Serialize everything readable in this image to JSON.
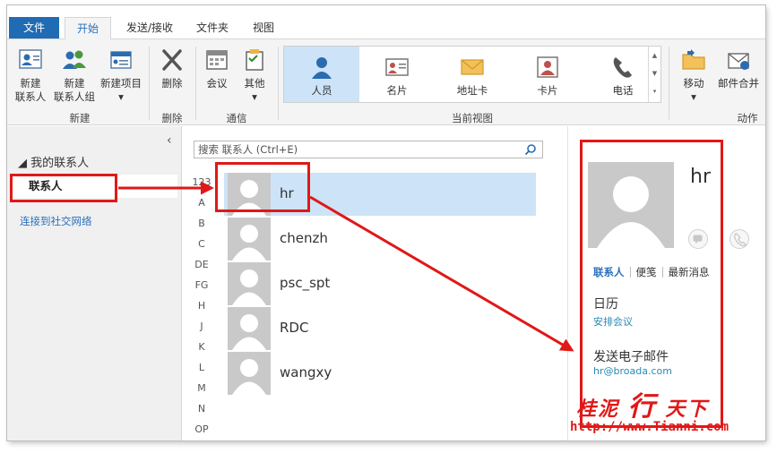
{
  "tabs": {
    "file": "文件",
    "home": "开始",
    "send_receive": "发送/接收",
    "folder": "文件夹",
    "view": "视图"
  },
  "ribbon": {
    "new_contact": "新建\n联系人",
    "new_contact_l1": "新建",
    "new_contact_l2": "联系人",
    "new_group_l1": "新建",
    "new_group_l2": "联系人组",
    "new_items_l1": "新建项目",
    "new_items_l2": "▾",
    "group_new": "新建",
    "delete": "删除",
    "group_delete": "删除",
    "meeting": "会议",
    "more_l1": "其他",
    "more_l2": "▾",
    "group_communicate": "通信",
    "views": [
      {
        "label": "人员",
        "icon": "person-icon"
      },
      {
        "label": "名片",
        "icon": "business-card-icon"
      },
      {
        "label": "地址卡",
        "icon": "envelope-icon"
      },
      {
        "label": "卡片",
        "icon": "card-icon"
      },
      {
        "label": "电话",
        "icon": "phone-icon"
      }
    ],
    "group_current_view": "当前视图",
    "move_l1": "移动",
    "move_l2": "▾",
    "mail_merge": "邮件合并",
    "group_actions": "动作"
  },
  "leftnav": {
    "collapse": "‹",
    "my_contacts": "◢ 我的联系人",
    "contacts": "联系人",
    "connect_social": "连接到社交网络"
  },
  "list": {
    "search_placeholder": "搜索 联系人 (Ctrl+E)",
    "alphabet": [
      "123",
      "A",
      "B",
      "C",
      "DE",
      "FG",
      "H",
      "J",
      "K",
      "L",
      "M",
      "N",
      "OP"
    ],
    "contacts": [
      {
        "name": "hr",
        "selected": true
      },
      {
        "name": "chenzh",
        "selected": false
      },
      {
        "name": "psc_spt",
        "selected": false
      },
      {
        "name": "RDC",
        "selected": false
      },
      {
        "name": "wangxy",
        "selected": false
      }
    ]
  },
  "card": {
    "name": "hr",
    "tab_contact": "联系人",
    "tab_notes": "便笺",
    "tab_news": "最新消息",
    "calendar_title": "日历",
    "schedule_link": "安排会议",
    "email_title": "发送电子邮件",
    "email": "hr@broada.com"
  },
  "watermark": {
    "part1": "桂泥",
    "part2": "行",
    "part3": "天下",
    "url": "http://www.Tianni.com"
  },
  "colors": {
    "accent": "#1f6cb4",
    "selection": "#cde3f7",
    "annotation": "#e01818",
    "link": "#2a6fbd"
  }
}
